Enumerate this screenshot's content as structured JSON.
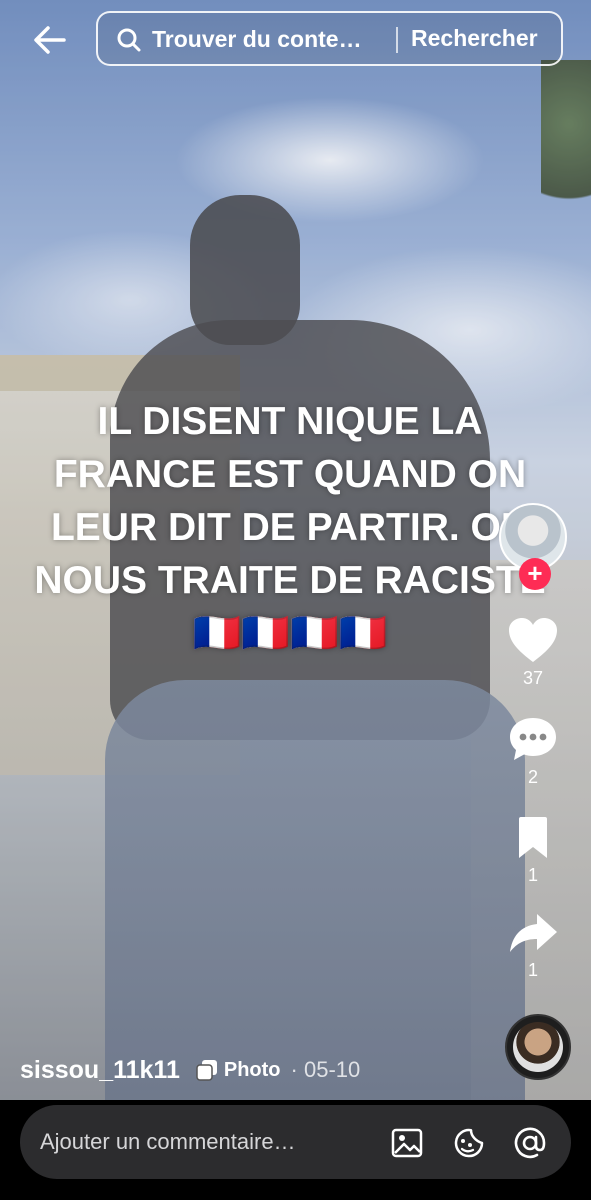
{
  "search": {
    "placeholder": "Trouver du conte…",
    "button_label": "Rechercher"
  },
  "post": {
    "caption": "IL DISENT NIQUE LA FRANCE EST QUAND ON LEUR DIT DE PARTIR. ON NOUS TRAITE DE RACISTE🇫🇷🇫🇷🇫🇷🇫🇷",
    "username": "sissou_11k11",
    "type_label": "Photo",
    "date": "· 05-10"
  },
  "actions": {
    "likes": "37",
    "comments": "2",
    "bookmarks": "1",
    "shares": "1"
  },
  "comment_bar": {
    "placeholder": "Ajouter un commentaire…"
  },
  "colors": {
    "follow_accent": "#fe2c55",
    "bottom_bar": "#000000",
    "comment_field": "#2c2c2e"
  },
  "icons": [
    "back-arrow-icon",
    "search-icon",
    "plus-icon",
    "heart-icon",
    "comment-icon",
    "bookmark-icon",
    "share-icon",
    "photo-stack-icon",
    "image-icon",
    "emoji-icon",
    "at-icon"
  ]
}
